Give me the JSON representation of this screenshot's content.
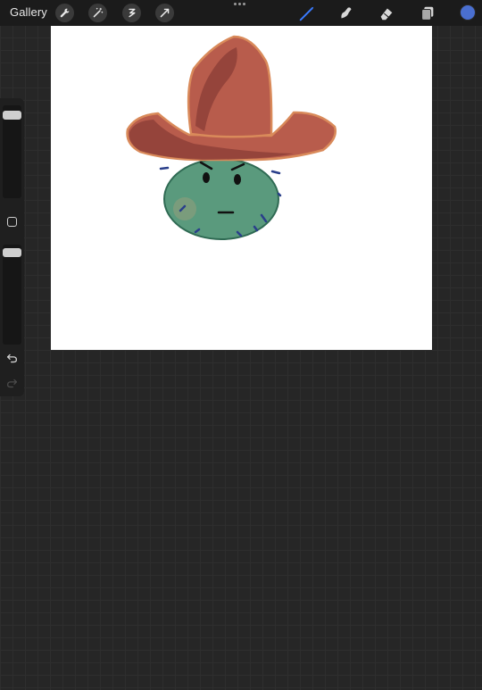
{
  "app": {
    "gallery_label": "Gallery"
  },
  "toolbar": {
    "left_tools": [
      {
        "icon": "wrench-icon",
        "name": "actions"
      },
      {
        "icon": "magic-wand-icon",
        "name": "adjustments"
      },
      {
        "icon": "selection-icon",
        "name": "selection"
      },
      {
        "icon": "transform-arrow-icon",
        "name": "transform"
      }
    ],
    "more_icon": "more-dots-icon",
    "right_tools": [
      {
        "icon": "brush-icon",
        "name": "paint",
        "active": true
      },
      {
        "icon": "smudge-icon",
        "name": "smudge",
        "active": false
      },
      {
        "icon": "eraser-icon",
        "name": "erase",
        "active": false
      },
      {
        "icon": "layers-icon",
        "name": "layers",
        "active": false
      }
    ],
    "current_color": "#4a6fd0"
  },
  "sidebar": {
    "brush_size_level": 0.06,
    "opacity_level": 0.04,
    "modify_icon": "square-modify-icon",
    "undo_icon": "undo-icon",
    "redo_icon": "redo-icon"
  },
  "colors": {
    "accent": "#3a7bff",
    "hat": "#b85c4c",
    "hat_shadow": "#8e3f38",
    "hat_outline": "#d98a5a",
    "cactus": "#5a9a7d",
    "cactus_outline": "#2f6a53",
    "spines": "#2a3f8a"
  }
}
